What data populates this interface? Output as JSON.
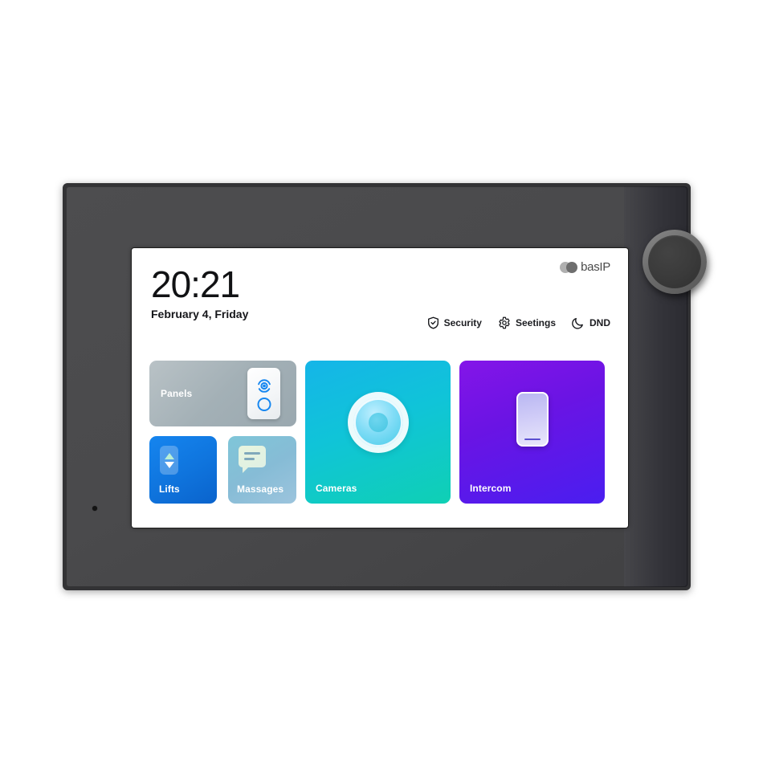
{
  "device": {
    "name": "basip-indoor-monitor",
    "knob_label": "rotary-knob",
    "frame_color": "#333335",
    "body_color": "#4a4a4c"
  },
  "screen": {
    "brand": {
      "logo_text": "basIP",
      "logo_icon": "two-overlapping-circles",
      "circle_left_color": "#b0b0b0",
      "circle_right_color": "#6e6e6e"
    },
    "clock": {
      "time": "20:21",
      "date": "February 4, Friday"
    },
    "status_items": [
      {
        "label": "Security",
        "icon": "shield-check-icon"
      },
      {
        "label": "Seetings",
        "icon": "gear-icon"
      },
      {
        "label": "DND",
        "icon": "moon-icon"
      }
    ],
    "tiles": [
      {
        "id": "panels",
        "label": "Panels",
        "icon": "door-panel-icon",
        "accent": "#1787f0",
        "background": "gray-blue-gradient"
      },
      {
        "id": "lifts",
        "label": "Lifts",
        "icon": "elevator-arrows-icon",
        "accent": "#1585ef",
        "background": "blue-gradient"
      },
      {
        "id": "massages",
        "label": "Massages",
        "icon": "speech-bubble-icon",
        "accent": "#7fa8bb",
        "background": "teal-blue-gradient"
      },
      {
        "id": "cameras",
        "label": "Cameras",
        "icon": "camera-lens-icon",
        "accent": "#10c4d8",
        "background": "cyan-teal-gradient"
      },
      {
        "id": "intercom",
        "label": "Intercom",
        "icon": "handset-device-icon",
        "accent": "#6a14e4",
        "background": "purple-violet-gradient"
      }
    ]
  }
}
